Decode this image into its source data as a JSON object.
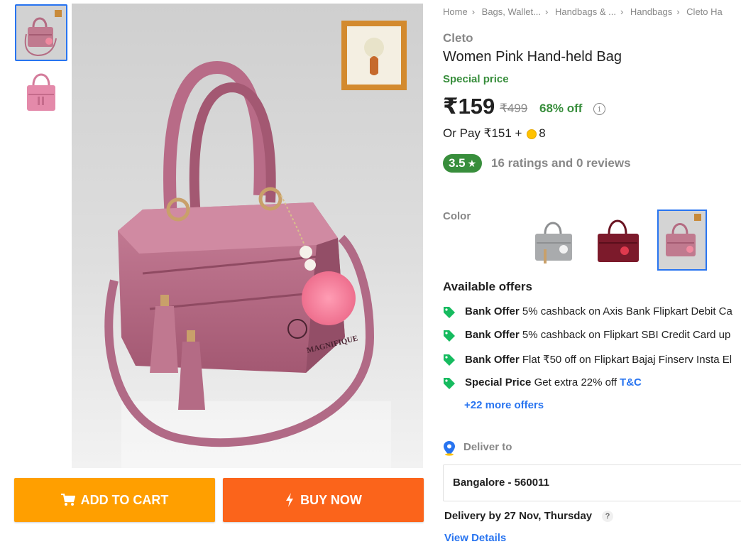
{
  "breadcrumbs": [
    "Home",
    "Bags, Wallet...",
    "Handbags & ...",
    "Handbags",
    "Cleto Ha"
  ],
  "product": {
    "brand": "Cleto",
    "title": "Women Pink Hand-held Bag",
    "special_label": "Special price",
    "price": "₹159",
    "mrp": "₹499",
    "discount": "68% off",
    "info_icon_text": "i",
    "or_pay_prefix": "Or Pay ₹151 +",
    "or_pay_coins": "8",
    "rating": "3.5",
    "rating_star": "★",
    "ratings_text": "16 ratings and 0 reviews"
  },
  "image_text": {
    "logo_text": "MAGNIFIQUE"
  },
  "color": {
    "label": "Color",
    "options": [
      "grey",
      "maroon",
      "pink"
    ],
    "selected": "pink"
  },
  "offers": {
    "heading": "Available offers",
    "items": [
      {
        "type": "Bank Offer",
        "text": "5% cashback on Axis Bank Flipkart Debit Ca",
        "tc": ""
      },
      {
        "type": "Bank Offer",
        "text": "5% cashback on Flipkart SBI Credit Card up",
        "tc": ""
      },
      {
        "type": "Bank Offer",
        "text": "Flat ₹50 off on Flipkart Bajaj Finserv Insta El",
        "tc": ""
      },
      {
        "type": "Special Price",
        "text": "Get extra 22% off",
        "tc": "T&C"
      }
    ],
    "more": "+22 more offers"
  },
  "delivery": {
    "label": "Deliver to",
    "pincode": "Bangalore - 560011",
    "by_text": "Delivery by 27 Nov, Thursday",
    "help": "?",
    "view_details": "View Details"
  },
  "actions": {
    "add_to_cart": "ADD TO CART",
    "buy_now": "BUY NOW"
  },
  "colors": {
    "primary_blue": "#2874f0",
    "green": "#388e3c",
    "cart_orange": "#ff9f00",
    "buy_orange": "#fb641b",
    "muted": "#878787"
  },
  "icons": [
    "heart-icon",
    "cart-icon",
    "lightning-icon",
    "tag-icon",
    "location-pin-icon",
    "info-icon",
    "coin-icon",
    "star-icon",
    "help-icon"
  ]
}
